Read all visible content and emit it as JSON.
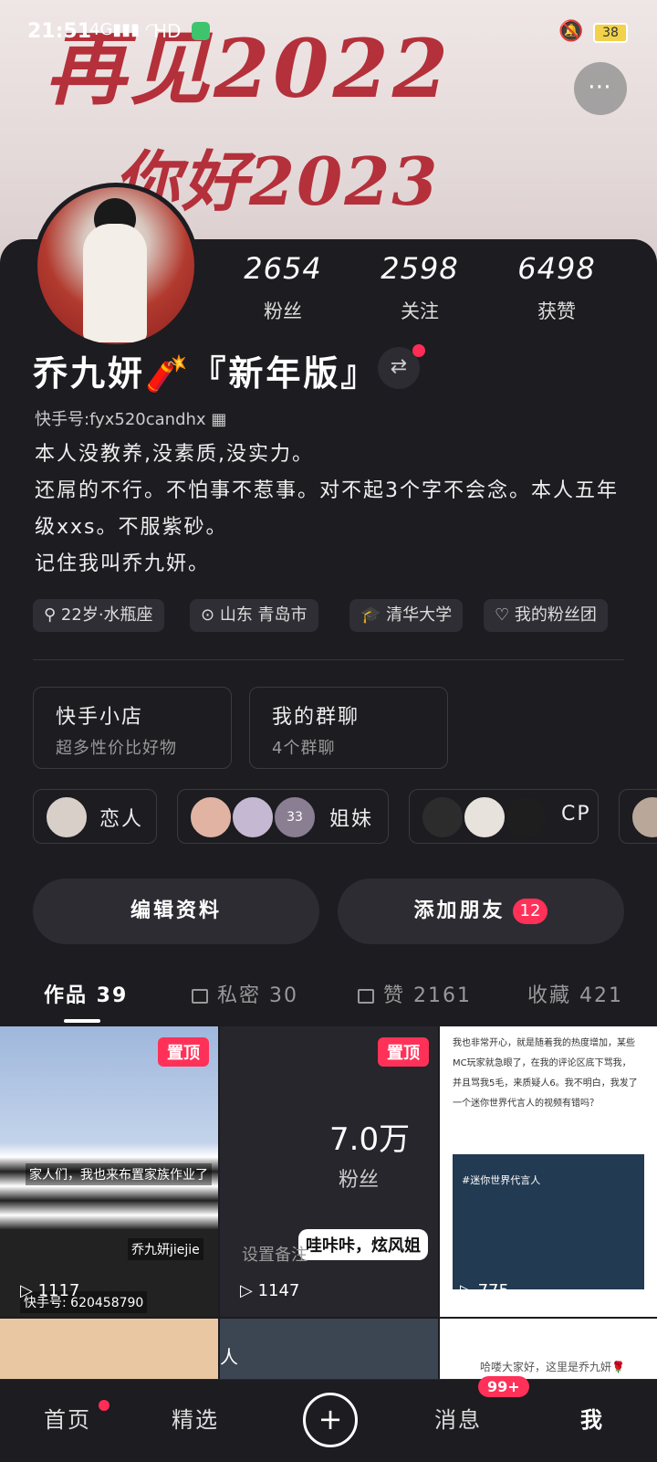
{
  "status_bar": {
    "time": "21:51",
    "network": "4G",
    "hd": "HD",
    "battery": "38"
  },
  "cover": {
    "line1": "再见2022",
    "line2": "你好2023"
  },
  "profile": {
    "name": "乔九妍🧨『新年版』",
    "kuaishou_id": "快手号:fyx520candhx",
    "bio": [
      "本人没教养,没素质,没实力。",
      "还屌的不行。不怕事不惹事。对不起3个字不会念。本人五年级xxs。不服紫砂。",
      "记住我叫乔九妍。"
    ],
    "stats": [
      {
        "num": "2654",
        "label": "粉丝"
      },
      {
        "num": "2598",
        "label": "关注"
      },
      {
        "num": "6498",
        "label": "获赞"
      }
    ],
    "tags": [
      "22岁·水瓶座",
      "山东 青岛市",
      "清华大学",
      "我的粉丝团"
    ]
  },
  "cards": [
    {
      "title": "快手小店",
      "sub": "超多性价比好物"
    },
    {
      "title": "我的群聊",
      "sub": "4个群聊"
    }
  ],
  "relations": [
    {
      "label": "恋人"
    },
    {
      "label": "姐妹",
      "extra": "33"
    },
    {
      "label": "CP"
    }
  ],
  "actions": {
    "edit": "编辑资料",
    "add_friend": "添加朋友",
    "friend_badge": "12"
  },
  "tabs": [
    {
      "label": "作品 39"
    },
    {
      "label": "私密 30"
    },
    {
      "label": "赞 2161"
    },
    {
      "label": "收藏 421"
    }
  ],
  "grid": [
    {
      "pin": "置顶",
      "plays": "1117",
      "caption": "家人们，我也来布置家族作业了",
      "tag": "乔九妍jiejie",
      "id_text": "快手号: 620458790"
    },
    {
      "pin": "置顶",
      "plays": "1147",
      "big": "7.0万",
      "sub": "粉丝",
      "bubble": "哇咔咔，炫风姐",
      "hint": "设置备注"
    },
    {
      "plays": "775",
      "text": "我也非常开心，就是随着我的热度增加，某些MC玩家就急眼了，在我的评论区底下骂我，并且骂我5毛，来质疑人6。我不明白，我发了一个迷你世界代言人的视频有错吗？",
      "tag": "#迷你世界代言人"
    },
    {},
    {
      "text": "人"
    },
    {
      "text": "哈喽大家好，这里是乔九妍🌹"
    }
  ],
  "nav": {
    "home": "首页",
    "featured": "精选",
    "messages": "消息",
    "msg_badge": "99+",
    "me": "我"
  }
}
